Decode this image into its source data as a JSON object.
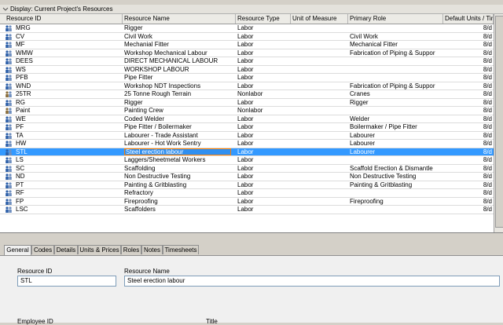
{
  "display": {
    "label": "Display: Current Project's Resources"
  },
  "columns": {
    "id": "Resource ID",
    "name": "Resource Name",
    "type": "Resource Type",
    "uom": "Unit of Measure",
    "role": "Primary Role",
    "units": "Default Units / Time"
  },
  "rows": [
    {
      "id": "MRG",
      "name": "Rigger",
      "type": "Labor",
      "role": "",
      "units": "8/d"
    },
    {
      "id": "CV",
      "name": "Civil Work",
      "type": "Labor",
      "role": "Civil Work",
      "units": "8/d"
    },
    {
      "id": "MF",
      "name": "Mechanial Fitter",
      "type": "Labor",
      "role": "Mechanical Fitter",
      "units": "8/d"
    },
    {
      "id": "WMW",
      "name": "Workshop Mechanical Labour",
      "type": "Labor",
      "role": "Fabrication of Piping & Suppor",
      "units": "8/d"
    },
    {
      "id": "DEES",
      "name": "DIRECT MECHANICAL LABOUR",
      "type": "Labor",
      "role": "",
      "units": "8/d"
    },
    {
      "id": "WS",
      "name": "WORKSHOP LABOUR",
      "type": "Labor",
      "role": "",
      "units": "8/d"
    },
    {
      "id": "PFB",
      "name": "Pipe Fitter",
      "type": "Labor",
      "role": "",
      "units": "8/d"
    },
    {
      "id": "WND",
      "name": "Workshop NDT Inspections",
      "type": "Labor",
      "role": "Fabrication of Piping & Suppor",
      "units": "8/d"
    },
    {
      "id": "25TR",
      "name": "25 Tonne Rough Terrain",
      "type": "Nonlabor",
      "role": "Cranes",
      "units": "8/d"
    },
    {
      "id": "RG",
      "name": "Rigger",
      "type": "Labor",
      "role": "Rigger",
      "units": "8/d"
    },
    {
      "id": "Paint",
      "name": "Painting Crew",
      "type": "Nonlabor",
      "role": "",
      "units": "8/d"
    },
    {
      "id": "WE",
      "name": "Coded Welder",
      "type": "Labor",
      "role": "Welder",
      "units": "8/d"
    },
    {
      "id": "PF",
      "name": "Pipe Fitter / Boilermaker",
      "type": "Labor",
      "role": "Boilermaker / Pipe Fitter",
      "units": "8/d"
    },
    {
      "id": "TA",
      "name": "Labourer - Trade Assistant",
      "type": "Labor",
      "role": "Labourer",
      "units": "8/d"
    },
    {
      "id": "HW",
      "name": "Labourer - Hot Work Sentry",
      "type": "Labor",
      "role": "Labourer",
      "units": "8/d"
    },
    {
      "id": "STL",
      "name": "Steel erection labour",
      "type": "Labor",
      "role": "Labourer",
      "units": "8/d",
      "selected": true
    },
    {
      "id": "LS",
      "name": "Laggers/Sheetmetal Workers",
      "type": "Labor",
      "role": "",
      "units": "8/d"
    },
    {
      "id": "SC",
      "name": "Scaffolding",
      "type": "Labor",
      "role": "Scaffold Erection & Dismantle",
      "units": "8/d"
    },
    {
      "id": "ND",
      "name": "Non Destructive Testing",
      "type": "Labor",
      "role": "Non Destructive Testing",
      "units": "8/d"
    },
    {
      "id": "PT",
      "name": "Painting & Gritblasting",
      "type": "Labor",
      "role": "Painting & Gritblasting",
      "units": "8/d"
    },
    {
      "id": "RF",
      "name": "Refractory",
      "type": "Labor",
      "role": "",
      "units": "8/d"
    },
    {
      "id": "FP",
      "name": "Fireproofing",
      "type": "Labor",
      "role": "Fireproofing",
      "units": "8/d"
    },
    {
      "id": "LSC",
      "name": "Scaffolders",
      "type": "Labor",
      "role": "",
      "units": "8/d"
    }
  ],
  "tabs": [
    "General",
    "Codes",
    "Details",
    "Units & Prices",
    "Roles",
    "Notes",
    "Timesheets"
  ],
  "detail": {
    "id_label": "Resource ID",
    "id_value": "STL",
    "name_label": "Resource Name",
    "name_value": "Steel erection labour",
    "employee_label": "Employee ID",
    "title_label": "Title"
  },
  "colors": {
    "selection": "#3399ff",
    "highlight_border": "#ff8000"
  }
}
